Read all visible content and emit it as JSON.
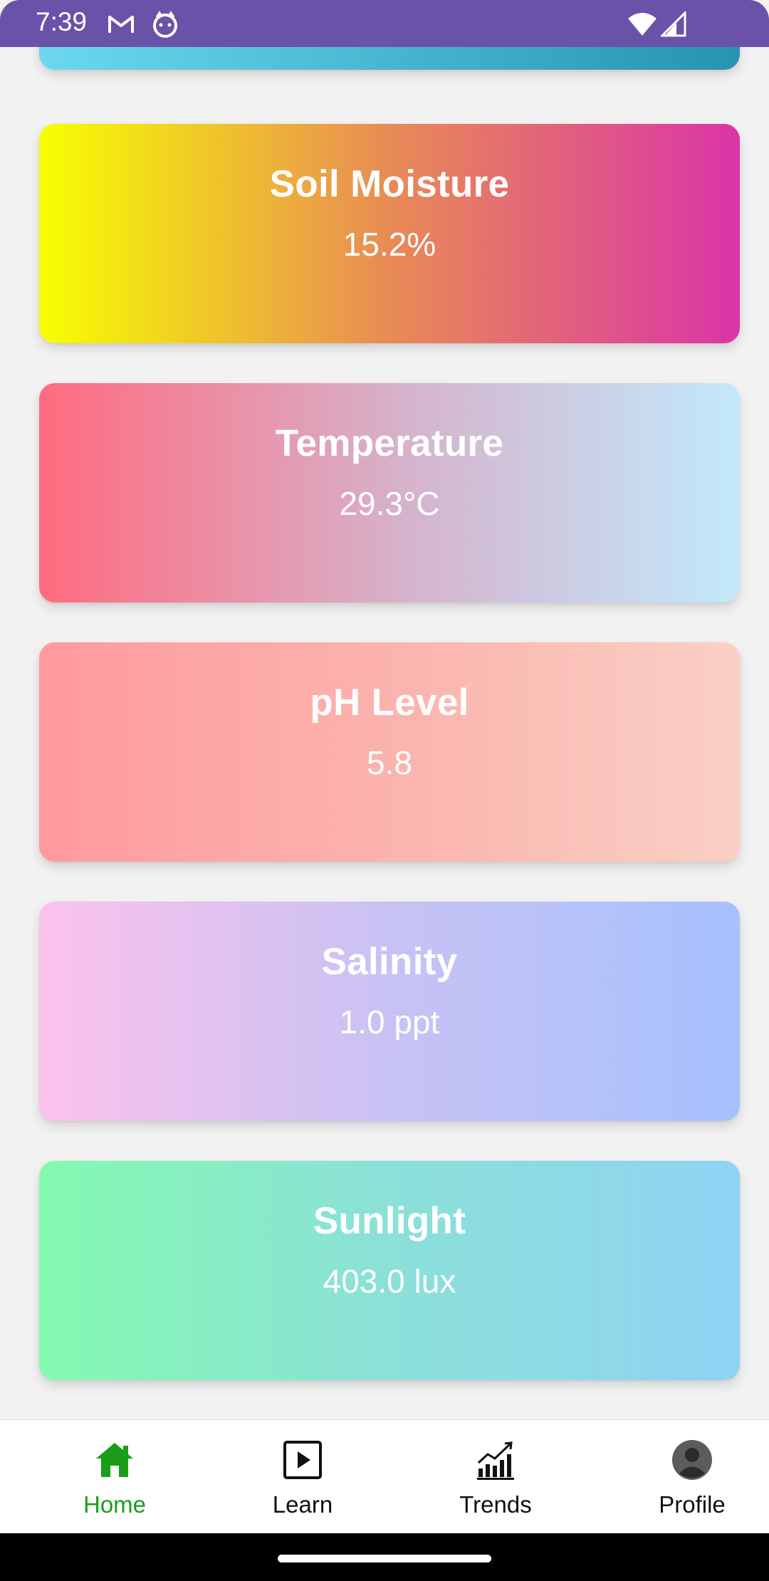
{
  "status_bar": {
    "time": "7:39",
    "left_icons": [
      "gmail-icon",
      "cat-icon"
    ],
    "right_icons": [
      "wifi-icon",
      "signal-icon"
    ]
  },
  "cards": [
    {
      "label": "",
      "value": "",
      "colors": [
        "#6bd8f0",
        "#2694b0"
      ]
    },
    {
      "label": "Soil Moisture",
      "value": "15.2%",
      "colors": [
        "#f7ff00",
        "#e88b55",
        "#db34a8"
      ]
    },
    {
      "label": "Temperature",
      "value": "29.3°C",
      "colors": [
        "#ff6b7f",
        "#d4b6cf",
        "#c2e9fb"
      ]
    },
    {
      "label": "pH Level",
      "value": "5.8",
      "colors": [
        "#ff9a9e",
        "#fbb3ae",
        "#fad0c4"
      ]
    },
    {
      "label": "Salinity",
      "value": "1.0 ppt",
      "colors": [
        "#fbc2eb",
        "#c8c2f4",
        "#a6c1fe"
      ]
    },
    {
      "label": "Sunlight",
      "value": "403.0 lux",
      "colors": [
        "#84fab0",
        "#8be0d8",
        "#8fd3f4"
      ]
    }
  ],
  "bottom_nav": {
    "active": "Home",
    "active_color": "#1a9e1a",
    "items": [
      {
        "label": "Home",
        "icon": "home-icon"
      },
      {
        "label": "Learn",
        "icon": "play-icon"
      },
      {
        "label": "Trends",
        "icon": "chart-trend-icon"
      },
      {
        "label": "Profile",
        "icon": "profile-icon"
      }
    ]
  }
}
